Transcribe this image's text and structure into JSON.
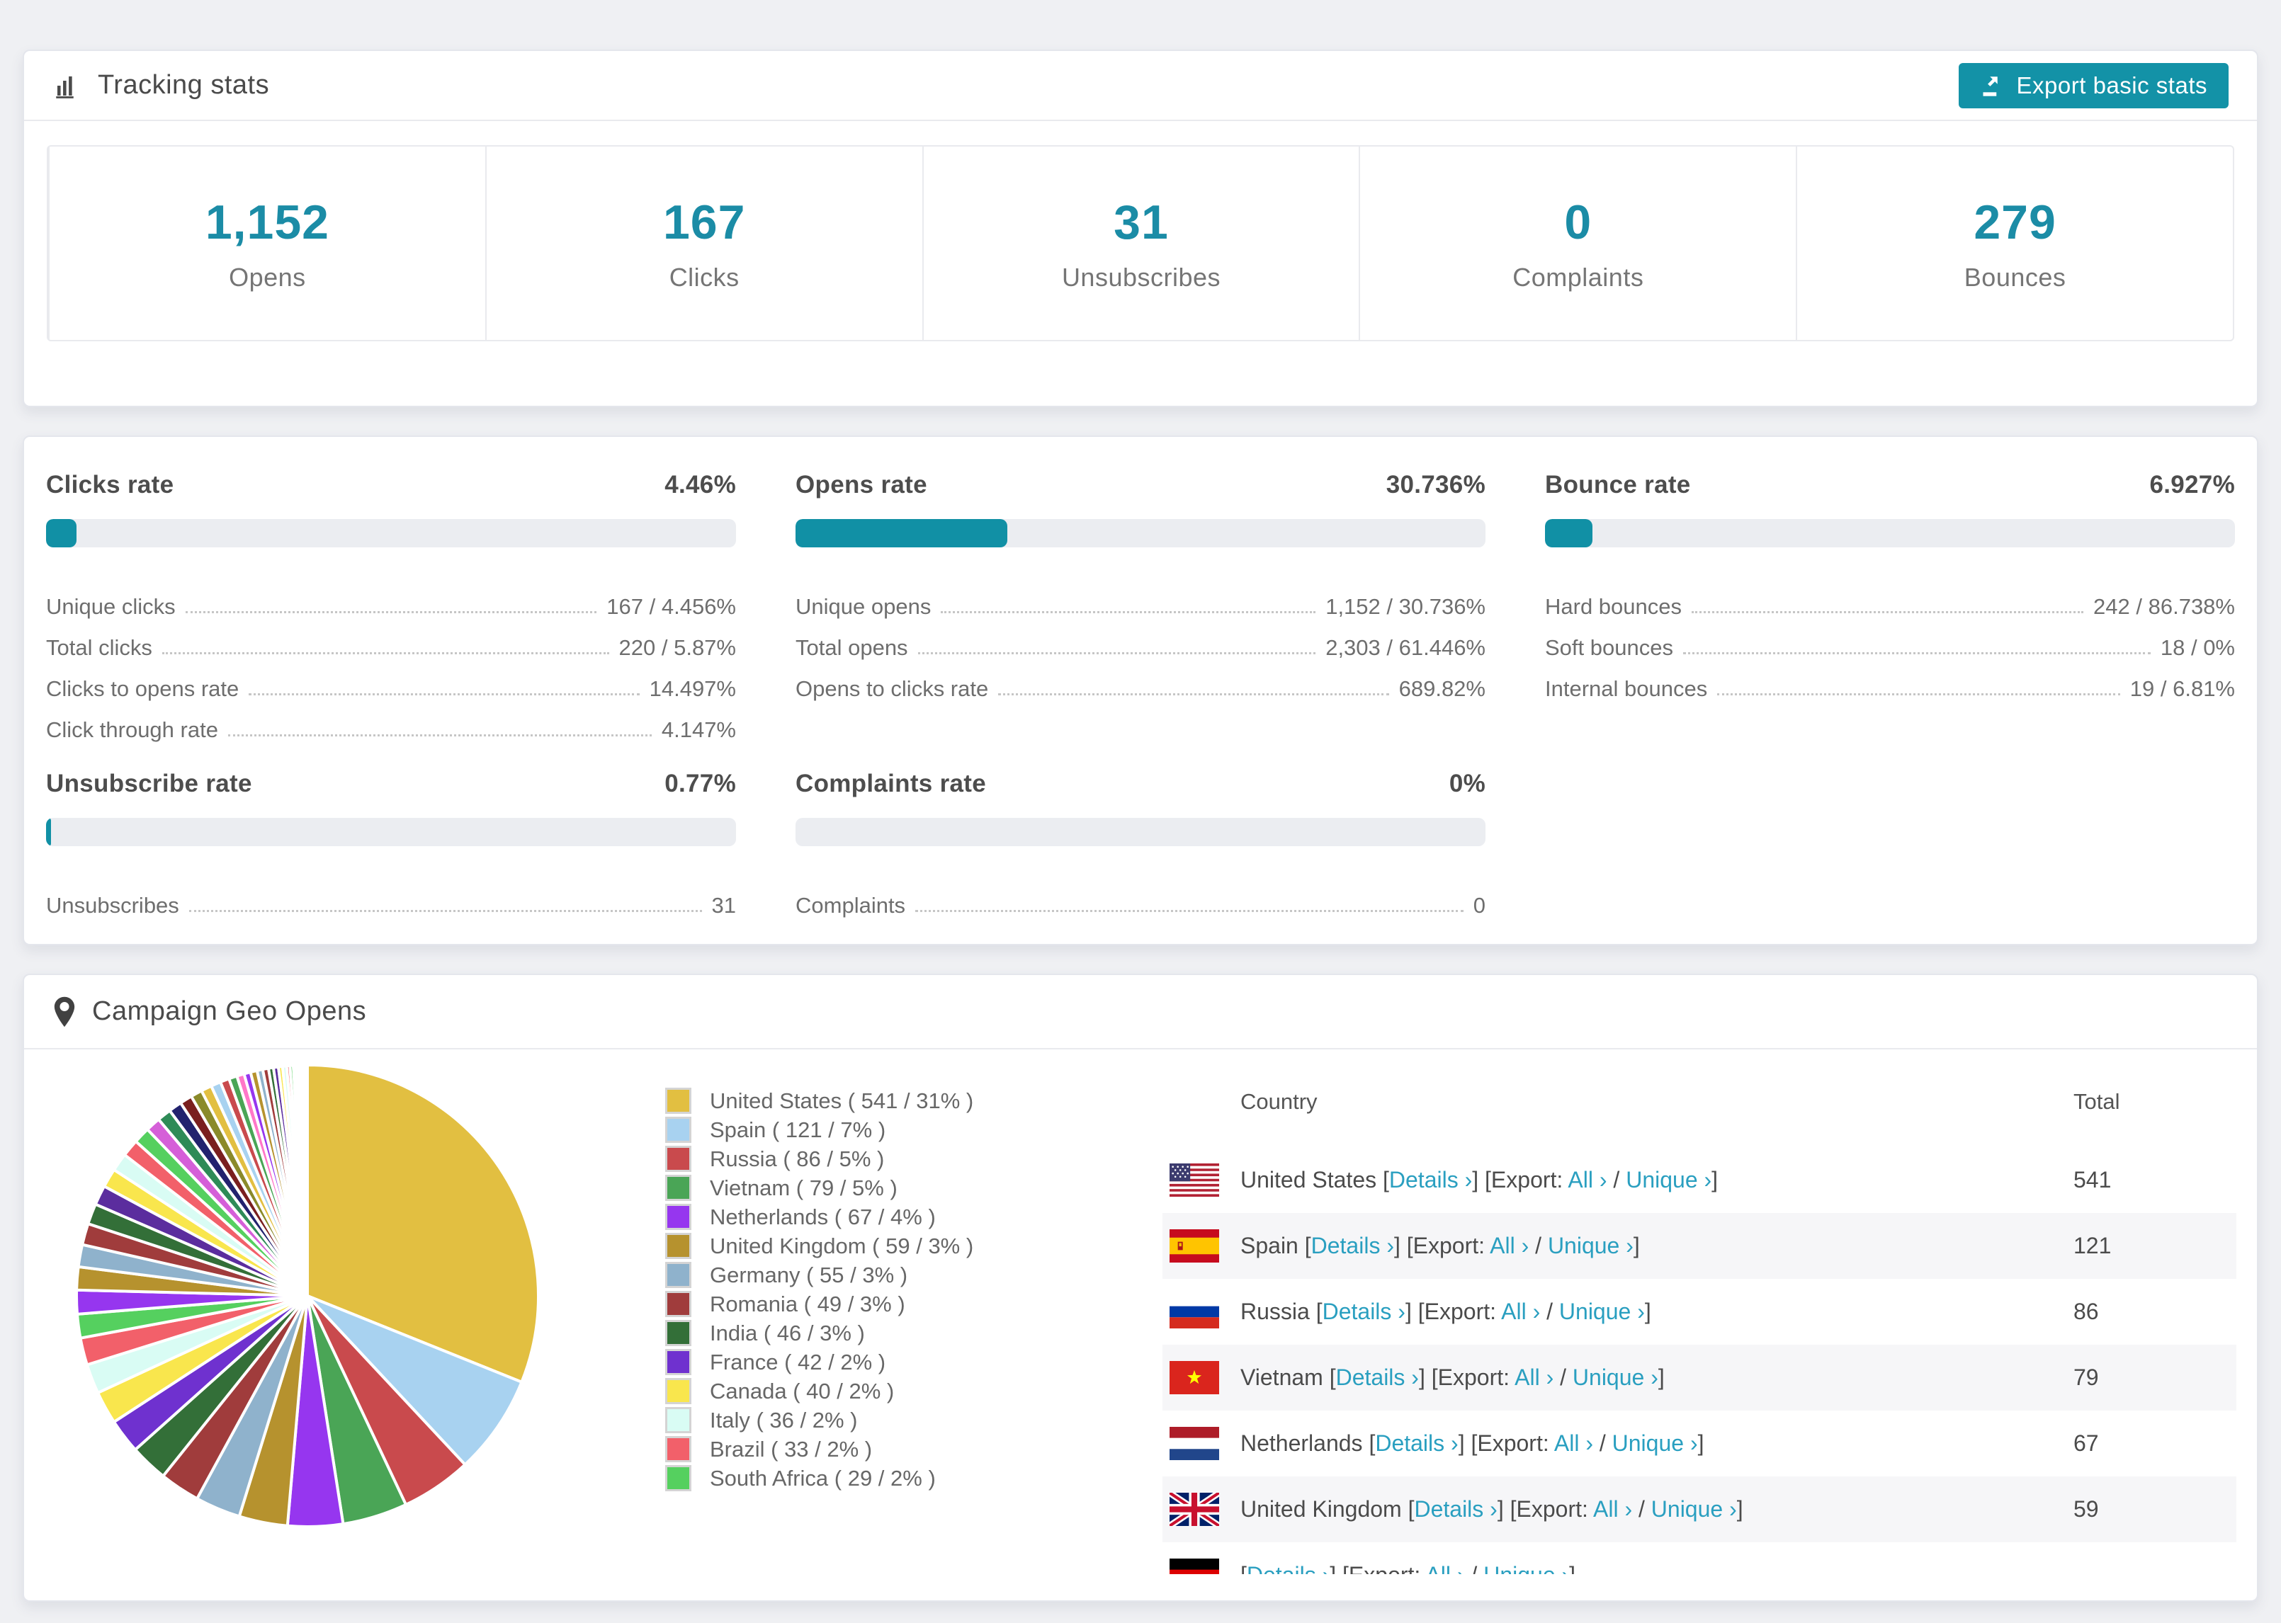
{
  "colors": {
    "accent": "#1392a7",
    "bar_fill": "#1190a5",
    "link": "#2a9fc0",
    "page_bg": "#eff0f3",
    "row_stripe": "#f6f6f8"
  },
  "tracking": {
    "title": "Tracking stats",
    "export_button": "Export basic stats",
    "stats": [
      {
        "value": "1,152",
        "label": "Opens"
      },
      {
        "value": "167",
        "label": "Clicks"
      },
      {
        "value": "31",
        "label": "Unsubscribes"
      },
      {
        "value": "0",
        "label": "Complaints"
      },
      {
        "value": "279",
        "label": "Bounces"
      }
    ]
  },
  "rates": {
    "clicks": {
      "title": "Clicks rate",
      "value": "4.46%",
      "rows": [
        {
          "label": "Unique clicks",
          "value": "167 / 4.456%"
        },
        {
          "label": "Total clicks",
          "value": "220 / 5.87%"
        },
        {
          "label": "Clicks to opens rate",
          "value": "14.497%"
        },
        {
          "label": "Click through rate",
          "value": "4.147%"
        }
      ]
    },
    "opens": {
      "title": "Opens rate",
      "value": "30.736%",
      "rows": [
        {
          "label": "Unique opens",
          "value": "1,152 / 30.736%"
        },
        {
          "label": "Total opens",
          "value": "2,303 / 61.446%"
        },
        {
          "label": "Opens to clicks rate",
          "value": "689.82%"
        }
      ]
    },
    "bounce": {
      "title": "Bounce rate",
      "value": "6.927%",
      "rows": [
        {
          "label": "Hard bounces",
          "value": "242 / 86.738%"
        },
        {
          "label": "Soft bounces",
          "value": "18 / 0%"
        },
        {
          "label": "Internal bounces",
          "value": "19 / 6.81%"
        }
      ]
    },
    "unsubscribe": {
      "title": "Unsubscribe rate",
      "value": "0.77%",
      "rows": [
        {
          "label": "Unsubscribes",
          "value": "31"
        }
      ]
    },
    "complaints": {
      "title": "Complaints rate",
      "value": "0%",
      "rows": [
        {
          "label": "Complaints",
          "value": "0"
        }
      ]
    }
  },
  "geo": {
    "title": "Campaign Geo Opens",
    "table": {
      "columns": {
        "country": "Country",
        "total": "Total"
      },
      "links": {
        "details": "Details ›",
        "export_label": "Export:",
        "all": "All ›",
        "unique": "Unique ›",
        "sep_open": " [",
        "sep_mid": "] [",
        "sep_space": " ",
        "sep_slash": " / ",
        "sep_close": "]"
      },
      "rows": [
        {
          "flag_ref": "#flag-us",
          "flag_name": "us-flag-icon",
          "country": "United States",
          "total": "541"
        },
        {
          "flag_ref": "#flag-es",
          "flag_name": "spain-flag-icon",
          "country": "Spain",
          "total": "121"
        },
        {
          "flag_ref": "#flag-ru",
          "flag_name": "russia-flag-icon",
          "country": "Russia",
          "total": "86"
        },
        {
          "flag_ref": "#flag-vn",
          "flag_name": "vietnam-flag-icon",
          "country": "Vietnam",
          "total": "79"
        },
        {
          "flag_ref": "#flag-nl",
          "flag_name": "netherlands-flag-icon",
          "country": "Netherlands",
          "total": "67"
        },
        {
          "flag_ref": "#flag-gb",
          "flag_name": "uk-flag-icon",
          "country": "United Kingdom",
          "total": "59"
        },
        {
          "flag_ref": "#flag-de",
          "flag_name": "germany-flag-icon",
          "country": "",
          "total": ""
        }
      ]
    }
  },
  "chart_data": {
    "type": "pie",
    "title": "Campaign Geo Opens",
    "legend_position": "right",
    "slices": [
      {
        "name": "United States",
        "value": 541,
        "pct": "31%",
        "color": "#e2bf41",
        "legend": "United States ( 541 / 31% )"
      },
      {
        "name": "Spain",
        "value": 121,
        "pct": "7%",
        "color": "#a8d2f0",
        "legend": "Spain ( 121 / 7% )"
      },
      {
        "name": "Russia",
        "value": 86,
        "pct": "5%",
        "color": "#c94a4d",
        "legend": "Russia ( 86 / 5% )"
      },
      {
        "name": "Vietnam",
        "value": 79,
        "pct": "5%",
        "color": "#4aa556",
        "legend": "Vietnam ( 79 / 5% )"
      },
      {
        "name": "Netherlands",
        "value": 67,
        "pct": "4%",
        "color": "#9636ef",
        "legend": "Netherlands ( 67 / 4% )"
      },
      {
        "name": "United Kingdom",
        "value": 59,
        "pct": "3%",
        "color": "#b6922e",
        "legend": "United Kingdom ( 59 / 3% )"
      },
      {
        "name": "Germany",
        "value": 55,
        "pct": "3%",
        "color": "#8fb2cc",
        "legend": "Germany ( 55 / 3% )"
      },
      {
        "name": "Romania",
        "value": 49,
        "pct": "3%",
        "color": "#a03c3c",
        "legend": "Romania ( 49 / 3% )"
      },
      {
        "name": "India",
        "value": 46,
        "pct": "3%",
        "color": "#336f38",
        "legend": "India ( 46 / 3% )"
      },
      {
        "name": "France",
        "value": 42,
        "pct": "2%",
        "color": "#6f31cf",
        "legend": "France ( 42 / 2% )"
      },
      {
        "name": "Canada",
        "value": 40,
        "pct": "2%",
        "color": "#f9e64d",
        "legend": "Canada ( 40 / 2% )"
      },
      {
        "name": "Italy",
        "value": 36,
        "pct": "2%",
        "color": "#d9fcf4",
        "legend": "Italy ( 36 / 2% )"
      },
      {
        "name": "Brazil",
        "value": 33,
        "pct": "2%",
        "color": "#f2606a",
        "legend": "Brazil ( 33 / 2% )"
      },
      {
        "name": "South Africa",
        "value": 29,
        "pct": "2%",
        "color": "#55d05f",
        "legend": "South Africa ( 29 / 2% )"
      }
    ],
    "others": [
      {
        "value": 29,
        "color": "#9636ef"
      },
      {
        "value": 28,
        "color": "#b6922e"
      },
      {
        "value": 27,
        "color": "#8fb2cc"
      },
      {
        "value": 26,
        "color": "#a03c3c"
      },
      {
        "value": 25,
        "color": "#336f38"
      },
      {
        "value": 24,
        "color": "#5b2d9e"
      },
      {
        "value": 23,
        "color": "#f9e64d"
      },
      {
        "value": 22,
        "color": "#d9fcf4"
      },
      {
        "value": 21,
        "color": "#f2606a"
      },
      {
        "value": 20,
        "color": "#55d05f"
      },
      {
        "value": 18,
        "color": "#d55fd8"
      },
      {
        "value": 17,
        "color": "#2e8b57"
      },
      {
        "value": 16,
        "color": "#22226e"
      },
      {
        "value": 15,
        "color": "#7a1f1f"
      },
      {
        "value": 14,
        "color": "#8a8a2a"
      },
      {
        "value": 13,
        "color": "#e2bf41"
      },
      {
        "value": 12,
        "color": "#a8d2f0"
      },
      {
        "value": 11,
        "color": "#c94a4d"
      },
      {
        "value": 10,
        "color": "#4aa556"
      },
      {
        "value": 9,
        "color": "#ff77c8"
      },
      {
        "value": 8,
        "color": "#9636ef"
      },
      {
        "value": 8,
        "color": "#b6922e"
      },
      {
        "value": 7,
        "color": "#8fb2cc"
      },
      {
        "value": 7,
        "color": "#a03c3c"
      },
      {
        "value": 6,
        "color": "#336f38"
      },
      {
        "value": 6,
        "color": "#5b2d9e"
      },
      {
        "value": 5,
        "color": "#f9e64d"
      },
      {
        "value": 5,
        "color": "#d9fcf4"
      },
      {
        "value": 4,
        "color": "#f2606a"
      },
      {
        "value": 4,
        "color": "#55d05f"
      },
      {
        "value": 3,
        "color": "#d55fd8"
      },
      {
        "value": 3,
        "color": "#2e8b57"
      },
      {
        "value": 2,
        "color": "#22226e"
      },
      {
        "value": 2,
        "color": "#7a1f1f"
      },
      {
        "value": 2,
        "color": "#8a8a2a"
      },
      {
        "value": 1,
        "color": "#e2bf41"
      },
      {
        "value": 1,
        "color": "#a8d2f0"
      },
      {
        "value": 1,
        "color": "#c94a4d"
      },
      {
        "value": 1,
        "color": "#4aa556"
      },
      {
        "value": 1,
        "color": "#ff77c8"
      }
    ]
  }
}
